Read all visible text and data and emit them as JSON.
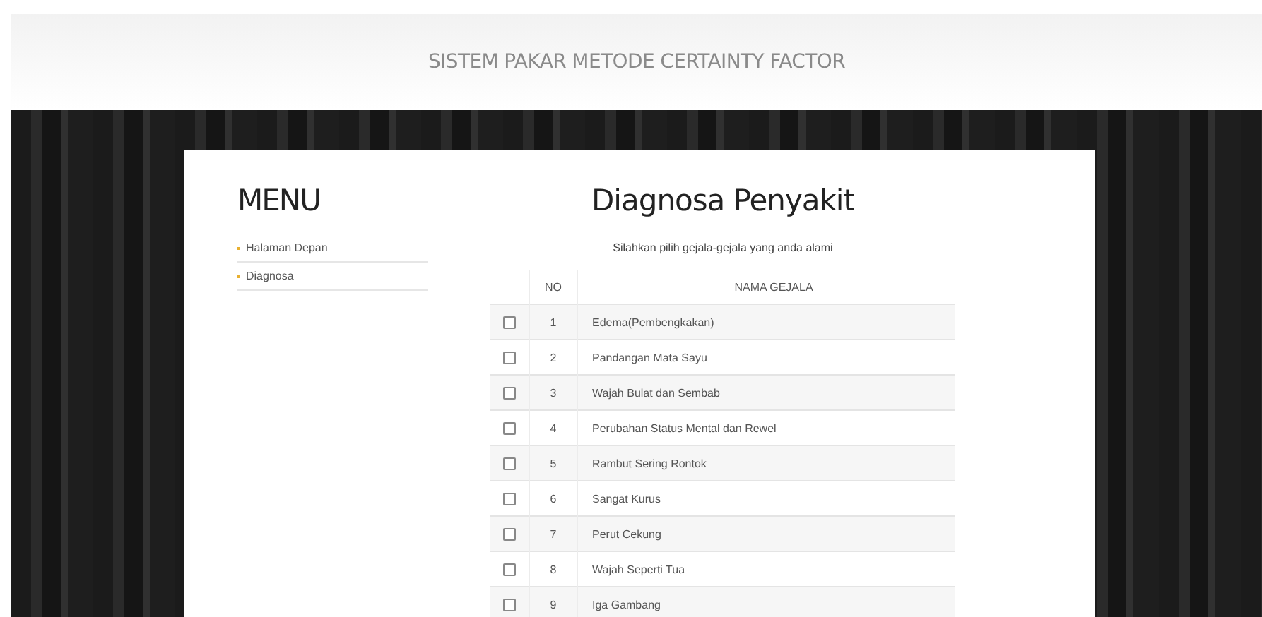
{
  "header": {
    "title": "SISTEM PAKAR METODE CERTAINTY FACTOR"
  },
  "sidebar": {
    "title": "MENU",
    "items": [
      {
        "label": "Halaman Depan"
      },
      {
        "label": "Diagnosa"
      }
    ]
  },
  "main": {
    "title": "Diagnosa Penyakit",
    "instruction": "Silahkan pilih gejala-gejala yang anda alami",
    "table": {
      "columns": [
        "NO",
        "NAMA GEJALA"
      ],
      "rows": [
        {
          "checked": false,
          "no": "1",
          "name": "Edema(Pembengkakan)"
        },
        {
          "checked": false,
          "no": "2",
          "name": "Pandangan Mata Sayu"
        },
        {
          "checked": false,
          "no": "3",
          "name": "Wajah Bulat dan Sembab"
        },
        {
          "checked": false,
          "no": "4",
          "name": "Perubahan Status Mental dan Rewel"
        },
        {
          "checked": false,
          "no": "5",
          "name": "Rambut Sering Rontok"
        },
        {
          "checked": false,
          "no": "6",
          "name": "Sangat Kurus"
        },
        {
          "checked": false,
          "no": "7",
          "name": "Perut Cekung"
        },
        {
          "checked": false,
          "no": "8",
          "name": "Wajah Seperti Tua"
        },
        {
          "checked": false,
          "no": "9",
          "name": "Iga Gambang"
        }
      ]
    }
  }
}
